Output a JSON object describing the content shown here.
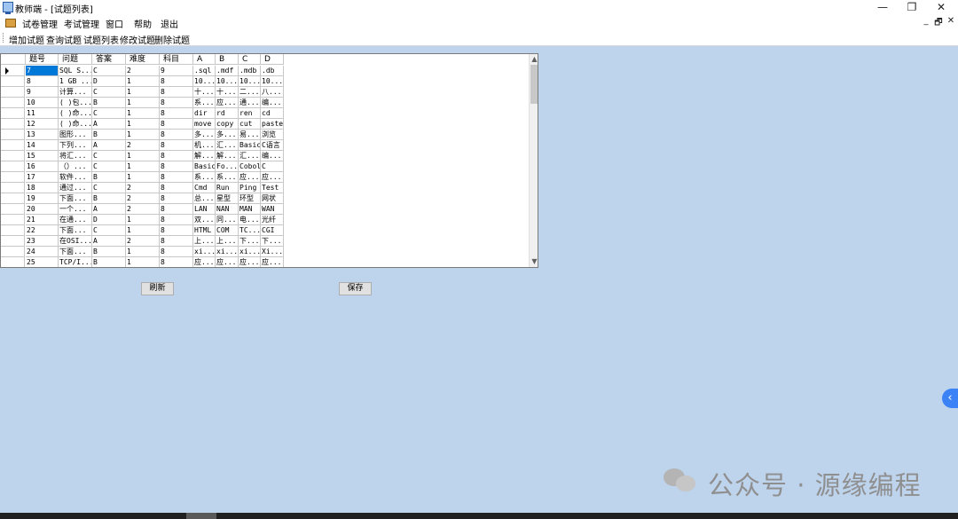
{
  "window": {
    "title": "教师端 - [试题列表]"
  },
  "window_controls": {
    "minimize": "—",
    "restore": "❐",
    "close": "✕"
  },
  "mdi_controls": {
    "minimize": "_",
    "restore": "🗗",
    "close": "✕"
  },
  "menu": [
    "试卷管理",
    "考试管理",
    "窗口",
    "帮助",
    "退出"
  ],
  "toolbar": [
    "增加试题",
    "查询试题",
    "试题列表",
    "修改试题",
    "删除试题"
  ],
  "grid": {
    "columns": [
      "题号",
      "问题",
      "答案",
      "难度",
      "科目",
      "A",
      "B",
      "C",
      "D"
    ],
    "rows": [
      [
        "7",
        "SQL S...",
        "C",
        "2",
        "9",
        ".sql",
        ".mdf",
        ".mdb",
        ".db"
      ],
      [
        "8",
        "1 GB ...",
        "D",
        "1",
        "8",
        "10...",
        "10...",
        "10...",
        "10..."
      ],
      [
        "9",
        "计算...",
        "C",
        "1",
        "8",
        "十...",
        "十...",
        "二...",
        "八..."
      ],
      [
        "10",
        "( )包...",
        "B",
        "1",
        "8",
        "系...",
        "应...",
        "通...",
        "编..."
      ],
      [
        "11",
        "( )命...",
        "C",
        "1",
        "8",
        "dir",
        "rd",
        "ren",
        "cd"
      ],
      [
        "12",
        "( )命...",
        "A",
        "1",
        "8",
        "move",
        "copy",
        "cut",
        "paste"
      ],
      [
        "13",
        "图形...",
        "B",
        "1",
        "8",
        "多...",
        "多...",
        "易...",
        "浏览"
      ],
      [
        "14",
        "下列...",
        "A",
        "2",
        "8",
        "机...",
        "汇...",
        "Basic",
        "C语言"
      ],
      [
        "15",
        "将汇...",
        "C",
        "1",
        "8",
        "解...",
        "解...",
        "汇...",
        "编..."
      ],
      [
        "16",
        "（）...",
        "C",
        "1",
        "8",
        "Basic",
        "Fo...",
        "Cobol",
        "C"
      ],
      [
        "17",
        "软件...",
        "B",
        "1",
        "8",
        "系...",
        "系...",
        "应...",
        "应..."
      ],
      [
        "18",
        "通过...",
        "C",
        "2",
        "8",
        "Cmd",
        "Run",
        "Ping",
        "Test"
      ],
      [
        "19",
        "下面...",
        "B",
        "2",
        "8",
        "总...",
        "星型",
        "环型",
        "网状"
      ],
      [
        "20",
        "一个...",
        "A",
        "2",
        "8",
        "LAN",
        "NAN",
        "MAN",
        "WAN"
      ],
      [
        "21",
        "在通...",
        "D",
        "1",
        "8",
        "双...",
        "同...",
        "电...",
        "光纤"
      ],
      [
        "22",
        "下面...",
        "C",
        "1",
        "8",
        "HTML",
        "COM",
        "TC...",
        "CGI"
      ],
      [
        "23",
        "在OSI...",
        "A",
        "2",
        "8",
        "上...",
        "上...",
        "下...",
        "下..."
      ],
      [
        "24",
        "下面...",
        "B",
        "1",
        "8",
        "xi...",
        "xi...",
        "xi...",
        "Xi..."
      ],
      [
        "25",
        "TCP/I...",
        "B",
        "1",
        "8",
        "应...",
        "应...",
        "应...",
        "应..."
      ]
    ]
  },
  "buttons": {
    "refresh": "刷新",
    "save": "保存"
  },
  "side_tab": "‹",
  "watermark": "公众号 · 源缘编程",
  "colors": {
    "mdi_background": "#bed3ec",
    "selection": "#0078d7",
    "side_tab": "#3b82f6"
  }
}
